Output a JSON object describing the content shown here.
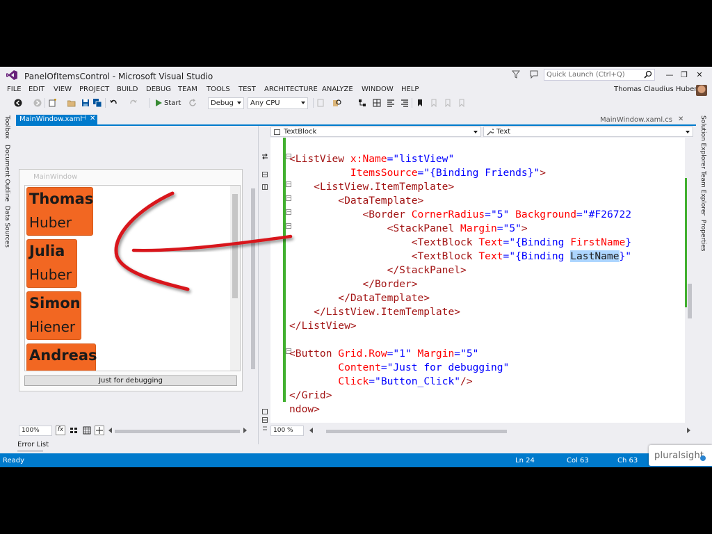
{
  "window": {
    "title": "PanelOfItemsControl - Microsoft Visual Studio",
    "quick_launch_placeholder": "Quick Launch (Ctrl+Q)",
    "user_name": "Thomas Claudius Huber"
  },
  "menu": [
    "FILE",
    "EDIT",
    "VIEW",
    "PROJECT",
    "BUILD",
    "DEBUG",
    "TEAM",
    "TOOLS",
    "TEST",
    "ARCHITECTURE",
    "ANALYZE",
    "WINDOW",
    "HELP"
  ],
  "toolbar": {
    "start_label": "Start",
    "configuration": "Debug",
    "platform": "Any CPU"
  },
  "left_tabs": [
    "Toolbox",
    "Document Outline",
    "Data Sources"
  ],
  "right_tabs": [
    "Solution Explorer",
    "Team Explorer",
    "Properties"
  ],
  "tabs": {
    "active": "MainWindow.xaml",
    "pin_glyph": "⊣",
    "close_glyph": "✕",
    "secondary": "MainWindow.xaml.cs"
  },
  "designer": {
    "window_title": "MainWindow",
    "friends": [
      {
        "first": "Thomas",
        "last": "Huber"
      },
      {
        "first": "Julia",
        "last": "Huber"
      },
      {
        "first": "Simon",
        "last": "Hiener"
      },
      {
        "first": "Andreas",
        "last": ""
      }
    ],
    "button_label": "Just for debugging",
    "zoom": "100%",
    "fx_label": "fx"
  },
  "editor": {
    "nav_left": "TextBlock",
    "nav_right": "Text",
    "zoom": "100 %",
    "lines": [
      [
        [
          "tg",
          "<ListView "
        ],
        [
          "at",
          "x:Name"
        ],
        [
          "pn",
          "="
        ],
        [
          "vl",
          "\"listView\""
        ]
      ],
      [
        [
          "",
          "          "
        ],
        [
          "at",
          "ItemsSource"
        ],
        [
          "pn",
          "="
        ],
        [
          "vl",
          "\"{Binding Friends}\""
        ],
        [
          "tg",
          ">"
        ]
      ],
      [
        [
          "",
          "    "
        ],
        [
          "tg",
          "<ListView.ItemTemplate>"
        ]
      ],
      [
        [
          "",
          "        "
        ],
        [
          "tg",
          "<DataTemplate>"
        ]
      ],
      [
        [
          "",
          "            "
        ],
        [
          "tg",
          "<Border "
        ],
        [
          "at",
          "CornerRadius"
        ],
        [
          "pn",
          "="
        ],
        [
          "vl",
          "\"5\" "
        ],
        [
          "at",
          "Background"
        ],
        [
          "pn",
          "="
        ],
        [
          "vl",
          "\"#F26722"
        ]
      ],
      [
        [
          "",
          "                "
        ],
        [
          "tg",
          "<StackPanel "
        ],
        [
          "at",
          "Margin"
        ],
        [
          "pn",
          "="
        ],
        [
          "vl",
          "\"5\""
        ],
        [
          "tg",
          ">"
        ]
      ],
      [
        [
          "",
          "                    "
        ],
        [
          "tg",
          "<TextBlock "
        ],
        [
          "at",
          "Text"
        ],
        [
          "pn",
          "="
        ],
        [
          "vl",
          "\"{Binding "
        ],
        [
          "at",
          "FirstName"
        ],
        [
          "vl",
          "}"
        ]
      ],
      [
        [
          "",
          "                    "
        ],
        [
          "tg",
          "<TextBlock "
        ],
        [
          "at",
          "Text"
        ],
        [
          "pn",
          "="
        ],
        [
          "vl",
          "\"{Binding "
        ],
        [
          "hl",
          "LastName"
        ],
        [
          "vl",
          "}\""
        ]
      ],
      [
        [
          "",
          "                "
        ],
        [
          "tg",
          "</StackPanel>"
        ]
      ],
      [
        [
          "",
          "            "
        ],
        [
          "tg",
          "</Border>"
        ]
      ],
      [
        [
          "",
          "        "
        ],
        [
          "tg",
          "</DataTemplate>"
        ]
      ],
      [
        [
          "",
          "    "
        ],
        [
          "tg",
          "</ListView.ItemTemplate>"
        ]
      ],
      [
        [
          "tg",
          "</ListView>"
        ]
      ],
      [
        [
          "",
          ""
        ]
      ],
      [
        [
          "tg",
          "<Button "
        ],
        [
          "at",
          "Grid.Row"
        ],
        [
          "pn",
          "="
        ],
        [
          "vl",
          "\"1\" "
        ],
        [
          "at",
          "Margin"
        ],
        [
          "pn",
          "="
        ],
        [
          "vl",
          "\"5\""
        ]
      ],
      [
        [
          "",
          "        "
        ],
        [
          "at",
          "Content"
        ],
        [
          "pn",
          "="
        ],
        [
          "vl",
          "\"Just for debugging\""
        ]
      ],
      [
        [
          "",
          "        "
        ],
        [
          "at",
          "Click"
        ],
        [
          "pn",
          "="
        ],
        [
          "vl",
          "\"Button_Click\""
        ],
        [
          "tg",
          "/>"
        ]
      ],
      [
        [
          "tg",
          "</Grid>"
        ]
      ],
      [
        [
          "tg",
          "ndow>"
        ]
      ]
    ]
  },
  "bottom": {
    "error_list": "Error List"
  },
  "status": {
    "ready": "Ready",
    "line": "Ln 24",
    "col": "Col 63",
    "ch": "Ch 63"
  },
  "branding": {
    "watermark": "pluralsight"
  },
  "colors": {
    "accent": "#007acc",
    "item_background": "#F26722",
    "annotation": "#d8161b"
  }
}
